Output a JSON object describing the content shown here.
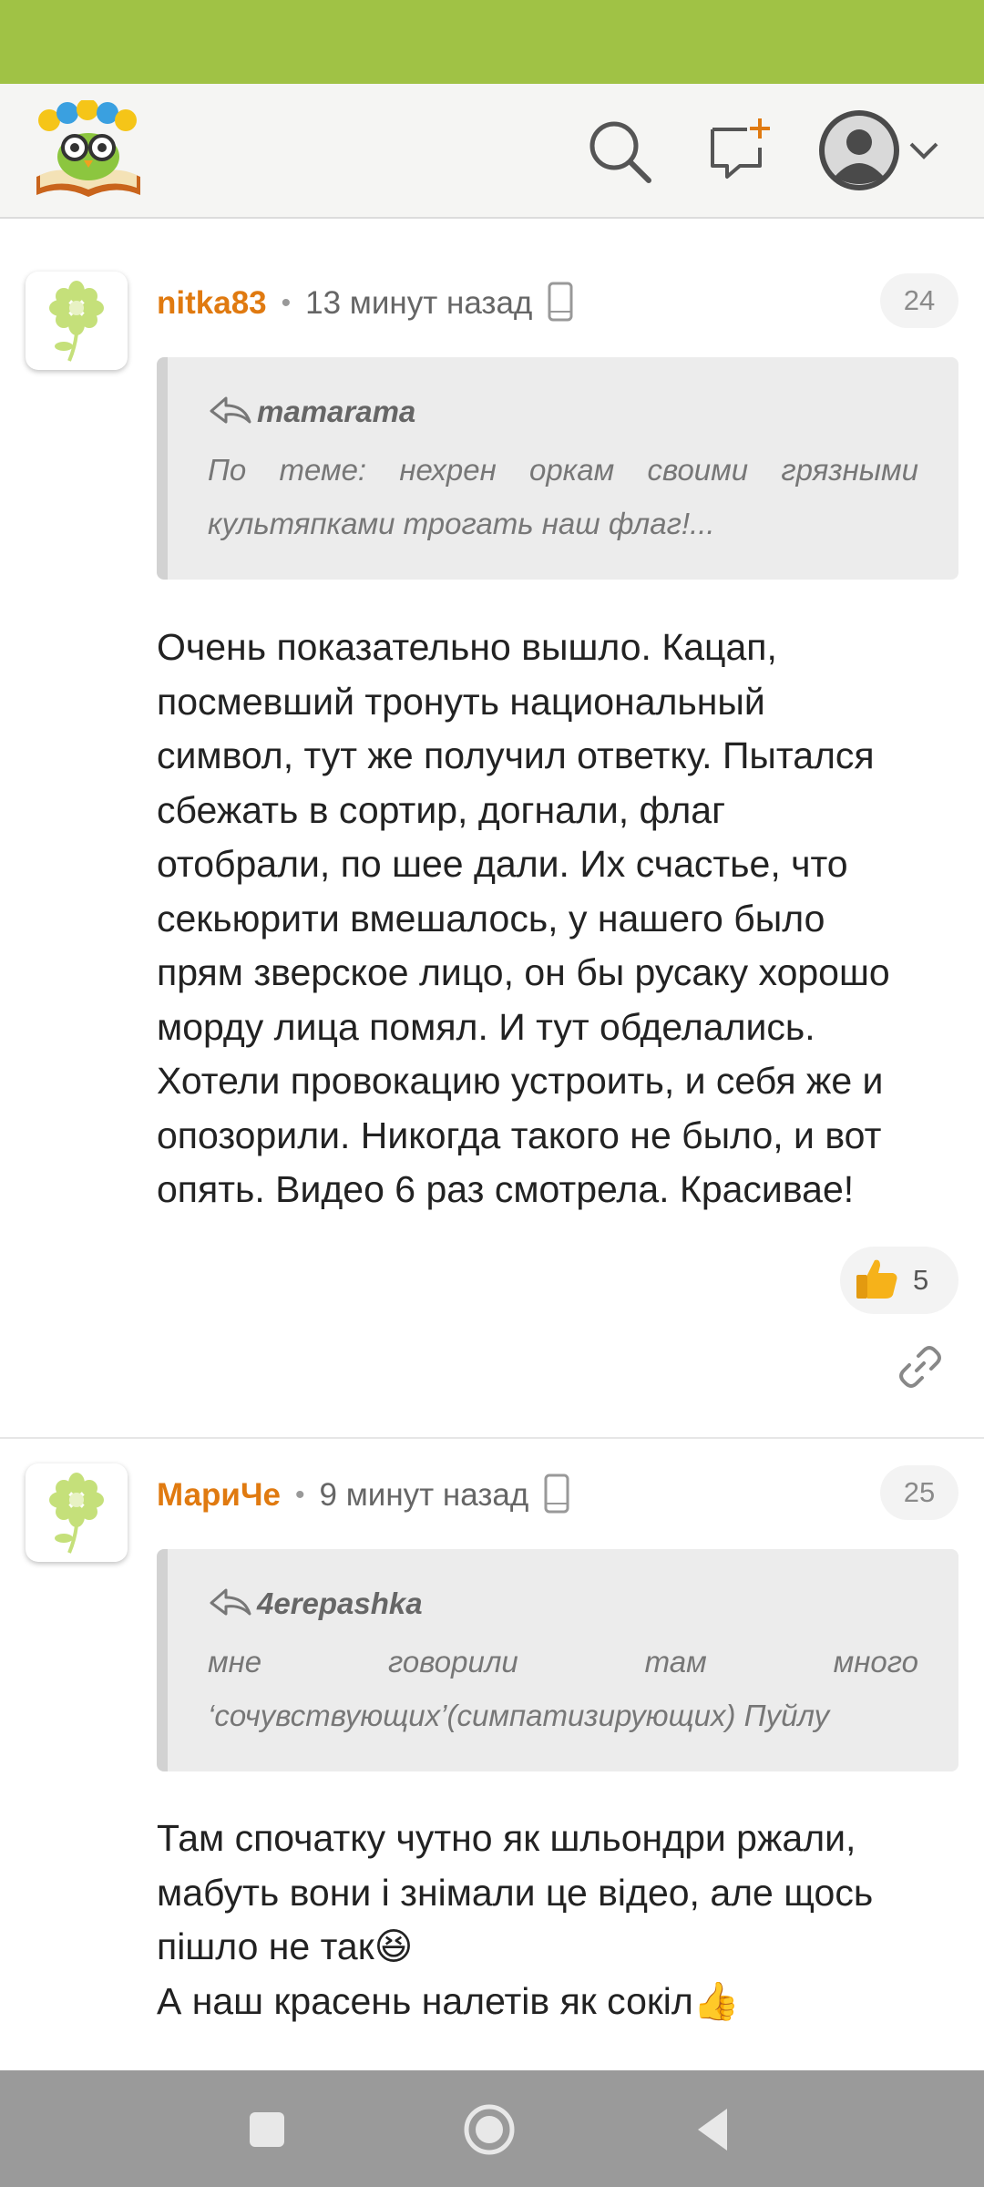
{
  "colors": {
    "accent": "#a0c245",
    "author": "#e07a10",
    "nav": "#9a9a9a"
  },
  "header": {
    "logo_icon": "site-logo-book-owl-icon",
    "search_icon": "search-icon",
    "compose_icon": "new-message-icon",
    "profile_icon": "user-avatar-icon",
    "menu_icon": "chevron-down-icon"
  },
  "comments": [
    {
      "author": "nitka83",
      "separator": "•",
      "time": "13 минут назад",
      "device_icon": "mobile-phone-icon",
      "number": "24",
      "quote": {
        "author": "mamarama",
        "text": "По теме: нехрен оркам своими грязными культяпками трогать наш флаг!..."
      },
      "lines": [
        "Очень показательно вышло. Кацап,",
        "посмевший тронуть национальный",
        "символ, тут же получил ответку. Пытался",
        "сбежать в сортир, догнали, флаг",
        "отобрали, по шее дали. Их счастье, что",
        "секьюрити вмешалось, у нашего было",
        "прям зверское лицо, он бы русаку хорошо",
        "морду лица помял. И тут обделались.",
        "Хотели провокацию устроить, и себя же и",
        "опозорили. Никогда такого не было, и вот",
        "опять. Видео 6 раз смотрела. Красивае!"
      ],
      "likes": "5",
      "like_icon": "thumbs-up-icon",
      "link_icon": "link-icon"
    },
    {
      "author": "МариЧе",
      "separator": "•",
      "time": "9 минут назад",
      "device_icon": "mobile-phone-icon",
      "number": "25",
      "quote": {
        "author": "4erepashka",
        "text": "мне говорили там много ‘сочувствующих’(симпатизирующих) Пуйлу"
      },
      "lines": [
        "Там спочатку чутно як шльондри ржали,",
        "мабуть вони і знімали це відео, але щось",
        "пішло не так😆",
        "А наш красень налетів як сокіл👍"
      ]
    }
  ],
  "navbar": {
    "recent_icon": "recent-apps-icon",
    "home_icon": "home-icon",
    "back_icon": "back-icon"
  }
}
